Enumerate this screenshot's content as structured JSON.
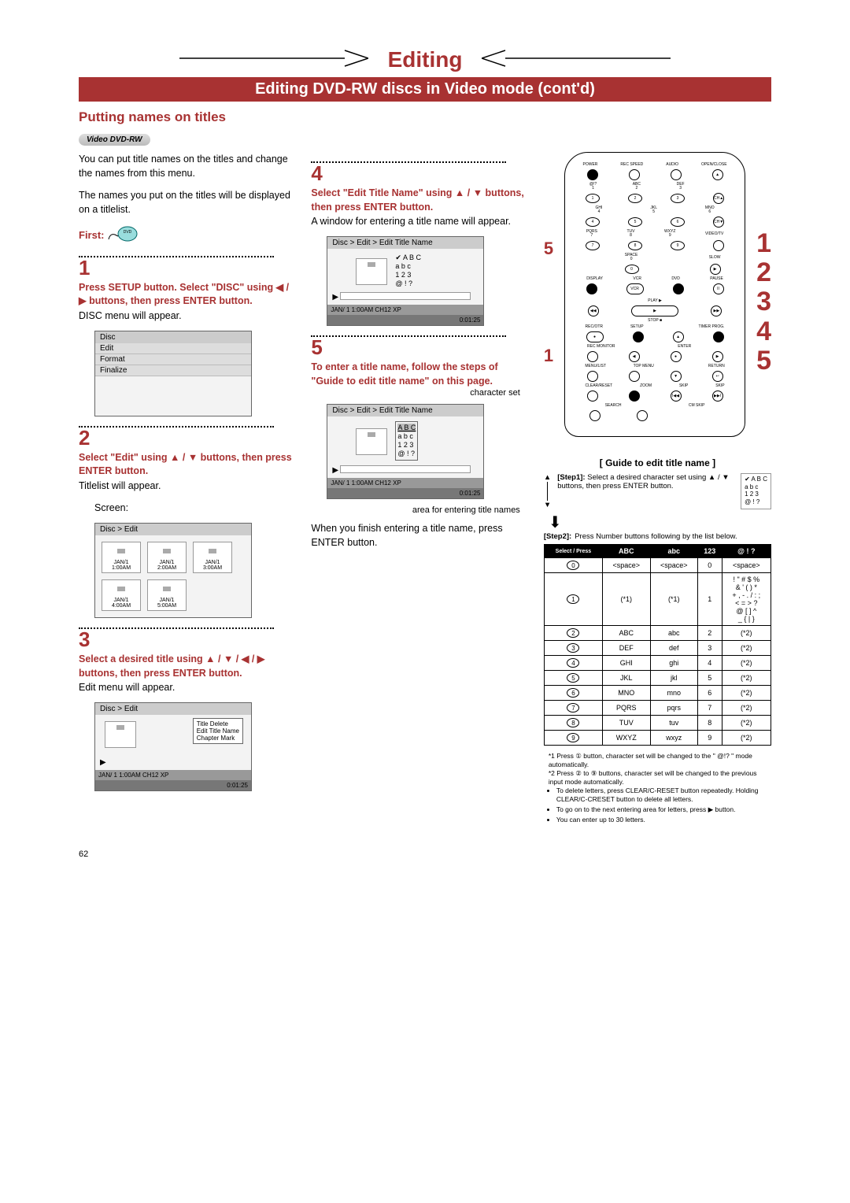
{
  "title": "Editing",
  "subtitle": "Editing DVD-RW discs in Video mode (cont'd)",
  "section_heading": "Putting names on titles",
  "badge": "Video DVD-RW",
  "intro_para1": "You can put title names on the titles and change the names from this menu.",
  "intro_para2": "The names you put on the titles will be displayed on a titlelist.",
  "first_label": "First:",
  "step1": {
    "num": "1",
    "heading": "Press SETUP button. Select \"DISC\" using ◀ / ▶ buttons, then press ENTER button.",
    "text": "DISC menu will appear.",
    "osd_header": "Disc",
    "osd_items": [
      "Edit",
      "Format",
      "Finalize"
    ]
  },
  "step2": {
    "num": "2",
    "heading": "Select \"Edit\" using ▲ / ▼ buttons, then press ENTER button.",
    "text": "Titlelist will appear.",
    "label": "Screen:",
    "osd_header": "Disc > Edit",
    "thumbs": [
      "JAN/1  1:00AM",
      "JAN/1  2:00AM",
      "JAN/1  3:00AM",
      "JAN/1  4:00AM",
      "JAN/1  5:00AM"
    ]
  },
  "step3": {
    "num": "3",
    "heading": "Select a desired title using ▲ / ▼ / ◀ / ▶ buttons, then press ENTER button.",
    "text": "Edit menu will appear.",
    "osd_header": "Disc > Edit",
    "submenu": [
      "Title Delete",
      "Edit Title Name",
      "Chapter Mark"
    ],
    "info_left": "JAN/ 1   1:00AM  CH12    XP",
    "info_right": "0:01:25"
  },
  "step4": {
    "num": "4",
    "heading": "Select \"Edit Title Name\" using ▲ / ▼ buttons, then press ENTER button.",
    "text": "A window for entering a title name will appear.",
    "osd_header": "Disc > Edit > Edit Title Name",
    "charset": [
      "✔  A B C",
      "a b c",
      "1 2 3",
      "@ ! ?"
    ],
    "info_left": "JAN/ 1   1:00AM  CH12    XP",
    "info_right": "0:01:25"
  },
  "step5": {
    "num": "5",
    "heading": "To enter a title name, follow the steps of \"Guide to edit title name\" on this page.",
    "caption_charset": "character set",
    "osd_header": "Disc > Edit > Edit Title Name",
    "charset": [
      "A B C",
      "a b c",
      "1 2 3",
      "@ ! ?"
    ],
    "info_left": "JAN/ 1   1:00AM  CH12    XP",
    "info_right": "0:01:25",
    "caption_area": "area for entering title names",
    "closing": "When you finish entering a title name, press ENTER button."
  },
  "remote_callouts": {
    "left5": "5",
    "left1": "1",
    "seq": [
      "1",
      "2",
      "3",
      "4",
      "5"
    ]
  },
  "guide": {
    "title": "[ Guide to edit title name ]",
    "step1_label": "[Step1]:",
    "step1_text": "Select a desired character set using ▲ / ▼ buttons, then press ENTER button.",
    "step1_charset": [
      "✔  A B C",
      "a b c",
      "1 2 3",
      "@ ! ?"
    ],
    "step2_label": "[Step2]:",
    "step2_text": "Press Number buttons following by the list below.",
    "table_header": [
      "ABC",
      "abc",
      "123",
      "@ ! ?"
    ],
    "diag_labels": "Select / Press",
    "rows": [
      {
        "key": "0",
        "cells": [
          "<space>",
          "<space>",
          "0",
          "<space>"
        ]
      },
      {
        "key": "1",
        "cells": [
          "(*1)",
          "(*1)",
          "1",
          "! \" # $ %\n& ' ( ) *\n+ , - . / : ;\n< = > ?\n@ [ ] ^\n_ { | }"
        ]
      },
      {
        "key": "2",
        "cells": [
          "ABC",
          "abc",
          "2",
          "(*2)"
        ]
      },
      {
        "key": "3",
        "cells": [
          "DEF",
          "def",
          "3",
          "(*2)"
        ]
      },
      {
        "key": "4",
        "cells": [
          "GHI",
          "ghi",
          "4",
          "(*2)"
        ]
      },
      {
        "key": "5",
        "cells": [
          "JKL",
          "jkl",
          "5",
          "(*2)"
        ]
      },
      {
        "key": "6",
        "cells": [
          "MNO",
          "mno",
          "6",
          "(*2)"
        ]
      },
      {
        "key": "7",
        "cells": [
          "PQRS",
          "pqrs",
          "7",
          "(*2)"
        ]
      },
      {
        "key": "8",
        "cells": [
          "TUV",
          "tuv",
          "8",
          "(*2)"
        ]
      },
      {
        "key": "9",
        "cells": [
          "WXYZ",
          "wxyz",
          "9",
          "(*2)"
        ]
      }
    ],
    "note1": "*1 Press ① button, character set will be changed to the \" @!? \" mode automatically.",
    "note2": "*2 Press ② to ⑨ buttons, character set will be changed to the previous input mode automatically.",
    "bullets": [
      "To delete letters, press CLEAR/C-RESET button repeatedly. Holding CLEAR/C-CRESET button to delete all letters.",
      "To go on to the next entering area for letters, press ▶ button.",
      "You can enter up to 30 letters."
    ]
  },
  "page_number": "62"
}
